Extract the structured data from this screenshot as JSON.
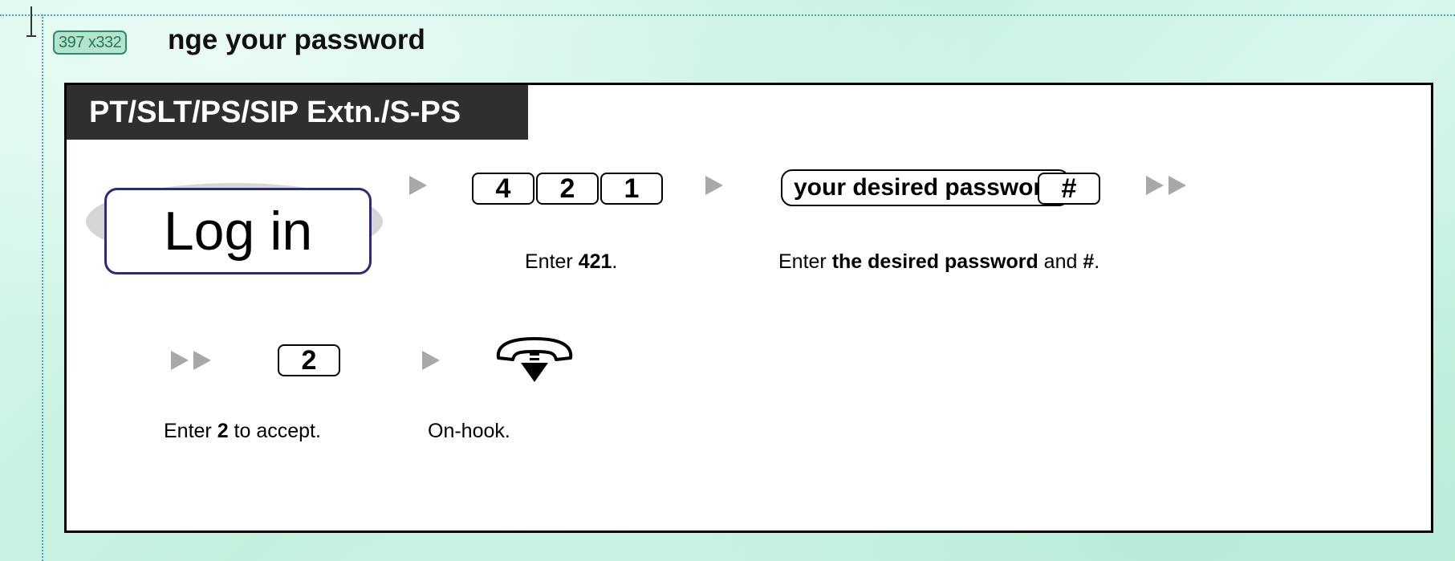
{
  "editor": {
    "image_size_badge": "397 x332"
  },
  "heading": {
    "visible_text": "nge your password"
  },
  "panel": {
    "header": "PT/SLT/PS/SIP Extn./S-PS",
    "login_label": "Log in",
    "keys_step1": [
      "4",
      "2",
      "1"
    ],
    "password_key": "your desired password",
    "hash_key": "#",
    "caption1": {
      "prefix": "Enter ",
      "bold": "421",
      "suffix": "."
    },
    "caption2": {
      "prefix": "Enter ",
      "bold1": "the desired password",
      "mid": " and ",
      "bold2": "#",
      "suffix": "."
    },
    "accept_key": "2",
    "caption3": {
      "prefix": "Enter ",
      "bold": "2",
      "suffix": " to accept."
    },
    "caption4": "On-hook.",
    "icons": {
      "arrow": "triangle-right-icon",
      "double_arrow": "double-triangle-right-icon",
      "onhook": "on-hook-handset-icon"
    }
  },
  "colors": {
    "background": "#c8f2e2",
    "guide": "#4aa8b4",
    "header_bg": "#2f2f2f",
    "login_border": "#2b2b7a",
    "arrow": "#a8a8a8"
  }
}
